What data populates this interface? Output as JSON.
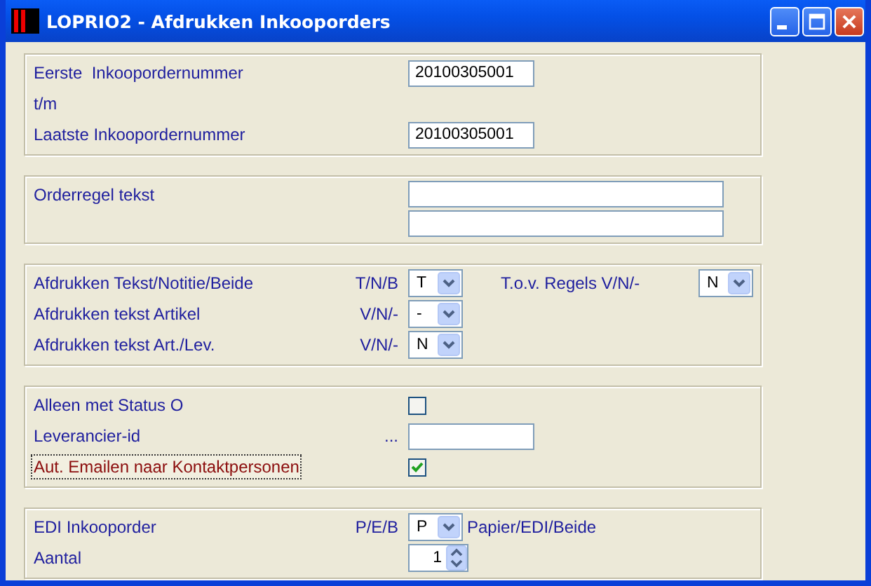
{
  "window": {
    "title": "LOPRIO2 - Afdrukken Inkooporders"
  },
  "groups": [
    {
      "rows": [
        {
          "kind": "input",
          "label": "Eerste  Inkoopordernummer",
          "value": "20100305001"
        },
        {
          "kind": "label",
          "label": "t/m"
        },
        {
          "kind": "input",
          "label": "Laatste Inkoopordernummer",
          "value": "20100305001"
        }
      ]
    },
    {
      "rows": [
        {
          "kind": "memo",
          "label": "Orderregel tekst"
        },
        {
          "kind": "memo"
        }
      ]
    },
    {
      "rows": [
        {
          "kind": "select",
          "label": "Afdrukken Tekst/Notitie/Beide",
          "hint": "T/N/B",
          "value": "T",
          "extra": {
            "label": "T.o.v. Regels V/N/-",
            "value": "N"
          }
        },
        {
          "kind": "select",
          "label": "Afdrukken tekst Artikel",
          "hint": "V/N/-",
          "value": "-"
        },
        {
          "kind": "select",
          "label": "Afdrukken tekst Art./Lev.",
          "hint": "V/N/-",
          "value": "N"
        }
      ]
    },
    {
      "rows": [
        {
          "kind": "checkbox",
          "label": "Alleen met Status O",
          "checked": false,
          "focused": false
        },
        {
          "kind": "input",
          "label": "Leverancier-id",
          "hint": "..."
        },
        {
          "kind": "checkbox",
          "label": "Aut. Emailen naar Kontaktpersonen",
          "checked": true,
          "focused": true
        }
      ]
    },
    {
      "rows": [
        {
          "kind": "select",
          "label": "EDI Inkooporder",
          "hint": "P/E/B",
          "value": "P",
          "after": "Papier/EDI/Beide"
        },
        {
          "kind": "spinner",
          "label": "Aantal",
          "value": "1"
        }
      ]
    }
  ]
}
